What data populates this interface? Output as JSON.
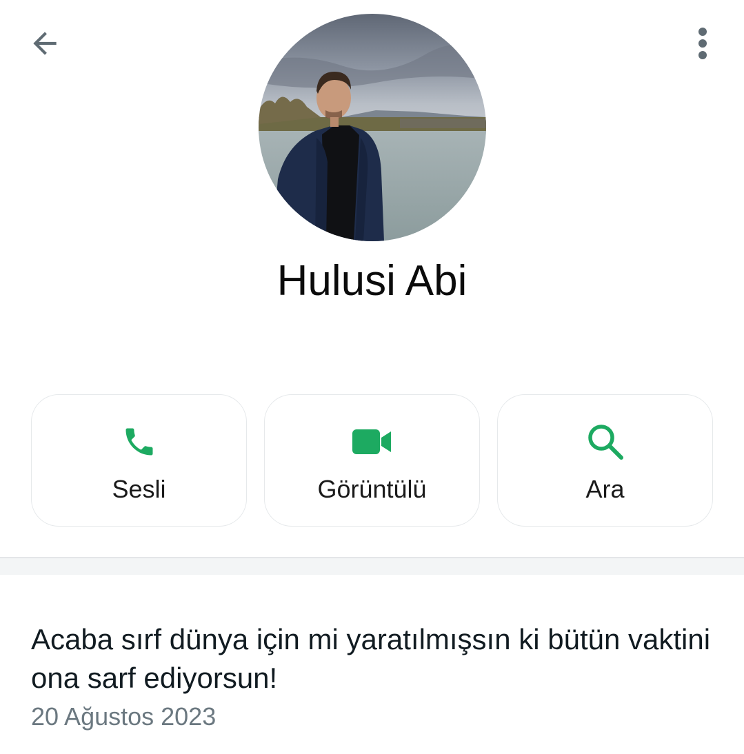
{
  "header": {
    "back_icon": "arrow-left-icon",
    "menu_icon": "more-vertical-icon"
  },
  "profile": {
    "name": "Hulusi Abi"
  },
  "actions": [
    {
      "label": "Sesli",
      "icon": "phone-icon"
    },
    {
      "label": "Görüntülü",
      "icon": "video-camera-icon"
    },
    {
      "label": "Ara",
      "icon": "search-icon"
    }
  ],
  "about": {
    "text": "Acaba sırf dünya için mi yaratılmışsın ki bütün vaktini ona sarf ediyorsun!",
    "date": "20 Ağustos 2023"
  },
  "colors": {
    "accent": "#1daa61",
    "icon_grey": "#667781",
    "divider": "#f3f5f6"
  }
}
